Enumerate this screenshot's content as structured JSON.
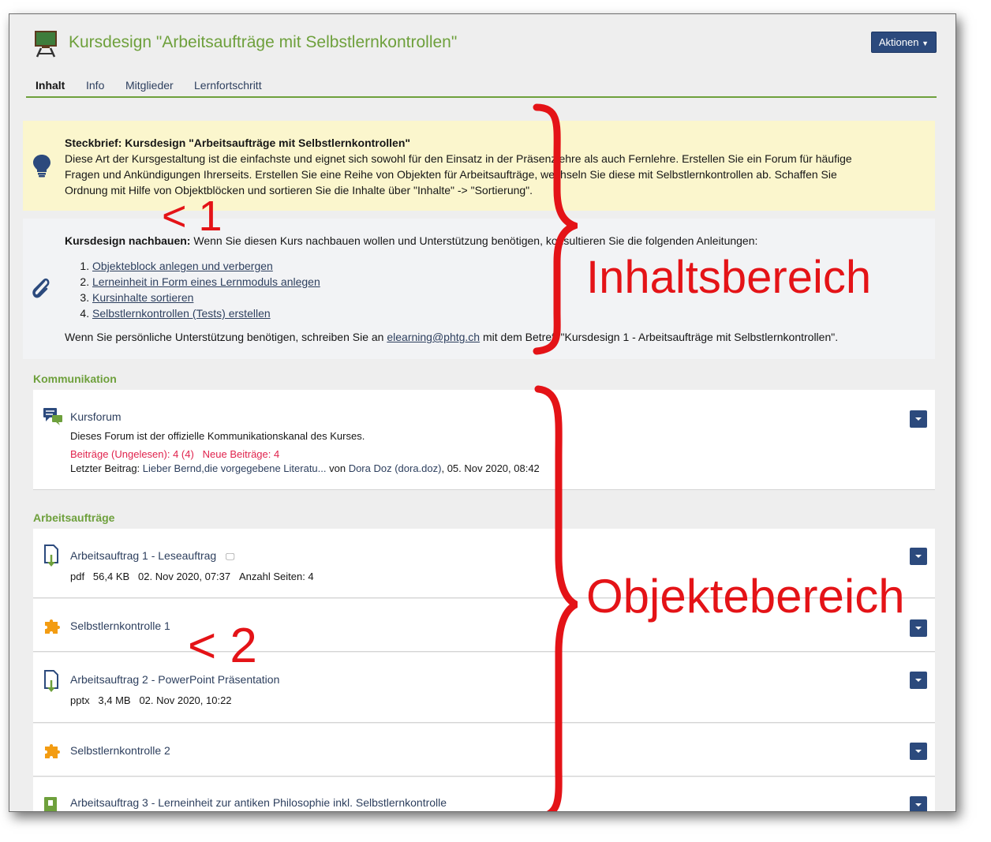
{
  "header": {
    "title": "Kursdesign \"Arbeitsaufträge mit Selbstlernkontrollen\"",
    "actions_label": "Aktionen",
    "course_icon": "blackboard-icon"
  },
  "tabs": [
    "Inhalt",
    "Info",
    "Mitglieder",
    "Lernfortschritt"
  ],
  "steckbrief": {
    "heading": "Steckbrief: Kursdesign \"Arbeitsaufträge mit Selbstlernkontrollen\"",
    "line1": "Diese Art der Kursgestaltung ist die einfachste und eignet sich sowohl für den Einsatz in der Präsenzlehre als auch Fernlehre. Erstellen Sie ein Forum für häufige",
    "line2": "Fragen und Ankündigungen Ihrerseits. Erstellen Sie eine Reihe von Objekten für Arbeitsaufträge, wechseln Sie diese mit Selbstlernkontrollen ab. Schaffen Sie",
    "line3": "Ordnung mit Hilfe von Objektblöcken und sortieren Sie die Inhalte über  \"Inhalte\" -> \"Sortierung\".",
    "icon": "lightbulb-icon"
  },
  "nachbauen": {
    "bold": "Kursdesign nachbauen:",
    "text": " Wenn Sie diesen Kurs nachbauen wollen und Unterstützung benötigen, konsultieren Sie die folgenden Anleitungen:",
    "guides": [
      "Objekteblock anlegen und verbergen",
      "Lerneinheit in Form eines Lernmoduls anlegen",
      "Kursinhalte sortieren",
      "Selbstlernkontrollen (Tests) erstellen"
    ],
    "support_pre": "Wenn Sie persönliche Unterstützung benötigen, schreiben Sie an ",
    "support_mail": "elearning@phtg.ch",
    "support_post": " mit dem Betreff \"Kursdesign 1 - Arbeitsaufträge mit Selbstlernkontrollen\".",
    "icon": "paperclip-icon"
  },
  "kommunikation": {
    "title": "Kommunikation",
    "forum": {
      "title": "Kursforum",
      "description": "Dieses Forum ist der offizielle Kommunikationskanal des Kurses.",
      "unread": "Beiträge (Ungelesen): 4 (4)",
      "new": "Neue Beiträge: 4",
      "last_label": "Letzter Beitrag: ",
      "last_post": "Lieber Bernd,die vorgegebene Literatu...",
      "von": " von ",
      "author": "Dora Doz (dora.doz)",
      "date": ", 05. Nov 2020, 08:42"
    }
  },
  "arbeitsauftraege": {
    "title": "Arbeitsaufträge",
    "items": [
      {
        "title": "Arbeitsauftrag 1 - Leseauftrag",
        "meta": [
          "pdf",
          "56,4 KB",
          "02. Nov 2020, 07:37",
          "Anzahl Seiten: 4"
        ]
      },
      {
        "title": "Selbstlernkontrolle 1"
      },
      {
        "title": "Arbeitsauftrag 2 - PowerPoint Präsentation",
        "meta": [
          "pptx",
          "3,4 MB",
          "02. Nov 2020, 10:22"
        ]
      },
      {
        "title": "Selbstlernkontrolle 2"
      },
      {
        "title": "Arbeitsauftrag 3 - Lerneinheit zur antiken Philosophie inkl. Selbstlernkontrolle"
      }
    ]
  },
  "annotations": {
    "marker1": "< 1",
    "marker2": "< 2",
    "inhalt": "Inhaltsbereich",
    "objekte": "Objektebereich",
    "color": "#e41317"
  }
}
